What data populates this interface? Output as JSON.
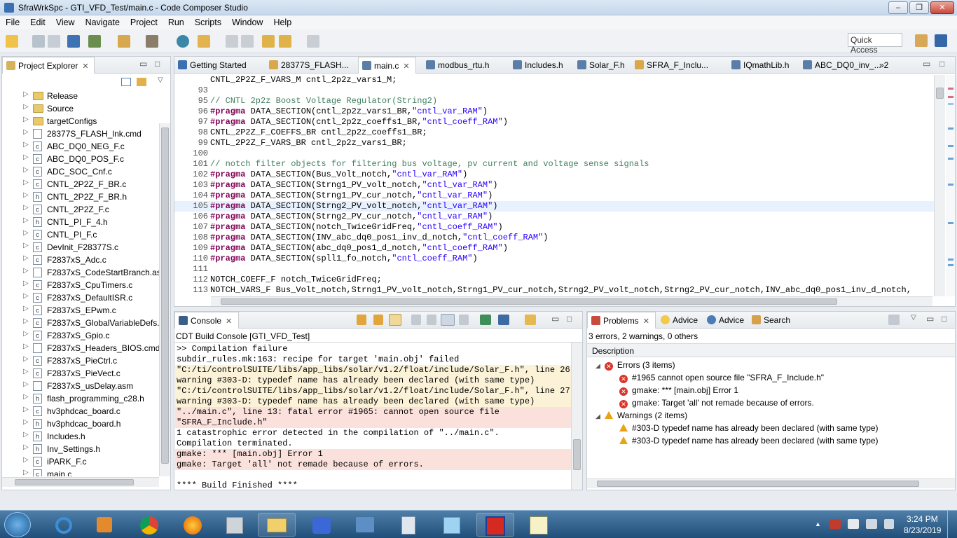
{
  "window": {
    "title": "SfraWrkSpc - GTI_VFD_Test/main.c - Code Composer Studio"
  },
  "menu": [
    "File",
    "Edit",
    "View",
    "Navigate",
    "Project",
    "Run",
    "Scripts",
    "Window",
    "Help"
  ],
  "toolbar": {
    "quick_access": "Quick Access"
  },
  "explorer": {
    "title": "Project Explorer",
    "items": [
      {
        "label": "Release",
        "kind": "folder"
      },
      {
        "label": "Source",
        "kind": "folder"
      },
      {
        "label": "targetConfigs",
        "kind": "folder"
      },
      {
        "label": "28377S_FLASH_lnk.cmd",
        "kind": "cmd"
      },
      {
        "label": "ABC_DQ0_NEG_F.c",
        "kind": "c"
      },
      {
        "label": "ABC_DQ0_POS_F.c",
        "kind": "c"
      },
      {
        "label": "ADC_SOC_Cnf.c",
        "kind": "c"
      },
      {
        "label": "CNTL_2P2Z_F_BR.c",
        "kind": "c"
      },
      {
        "label": "CNTL_2P2Z_F_BR.h",
        "kind": "h"
      },
      {
        "label": "CNTL_2P2Z_F.c",
        "kind": "c"
      },
      {
        "label": "CNTL_PI_F_4.h",
        "kind": "h"
      },
      {
        "label": "CNTL_PI_F.c",
        "kind": "c"
      },
      {
        "label": "DevInit_F28377S.c",
        "kind": "c"
      },
      {
        "label": "F2837xS_Adc.c",
        "kind": "c"
      },
      {
        "label": "F2837xS_CodeStartBranch.asm",
        "kind": "asm"
      },
      {
        "label": "F2837xS_CpuTimers.c",
        "kind": "c"
      },
      {
        "label": "F2837xS_DefaultISR.c",
        "kind": "c"
      },
      {
        "label": "F2837xS_EPwm.c",
        "kind": "c"
      },
      {
        "label": "F2837xS_GlobalVariableDefs.c",
        "kind": "c"
      },
      {
        "label": "F2837xS_Gpio.c",
        "kind": "c"
      },
      {
        "label": "F2837xS_Headers_BIOS.cmd",
        "kind": "cmd"
      },
      {
        "label": "F2837xS_PieCtrl.c",
        "kind": "c"
      },
      {
        "label": "F2837xS_PieVect.c",
        "kind": "c"
      },
      {
        "label": "F2837xS_usDelay.asm",
        "kind": "asm"
      },
      {
        "label": "flash_programming_c28.h",
        "kind": "h"
      },
      {
        "label": "hv3phdcac_board.c",
        "kind": "c"
      },
      {
        "label": "hv3phdcac_board.h",
        "kind": "h"
      },
      {
        "label": "Includes.h",
        "kind": "h"
      },
      {
        "label": "Inv_Settings.h",
        "kind": "h"
      },
      {
        "label": "iPARK_F.c",
        "kind": "c"
      },
      {
        "label": "main.c",
        "kind": "c"
      }
    ]
  },
  "editor": {
    "tabs": [
      "Getting Started",
      "28377S_FLASH...",
      "main.c",
      "modbus_rtu.h",
      "Includes.h",
      "Solar_F.h",
      "SFRA_F_Inclu...",
      "IQmathLib.h",
      "ABC_DQ0_inv_..."
    ],
    "overflow": "»2",
    "lines": [
      {
        "n": "",
        "t": "CNTL_2P2Z_F_VARS_M cntl_2p2z_vars1_M;"
      },
      {
        "n": "93",
        "t": ""
      },
      {
        "n": "95",
        "t": "// CNTL 2p2z Boost Voltage Regulator(String2)"
      },
      {
        "n": "96",
        "k": "#pragma",
        "t": " DATA_SECTION(cntl_2p2z_vars1_BR,",
        "s": "\"cntl_var_RAM\"",
        "e": ")"
      },
      {
        "n": "97",
        "k": "#pragma",
        "t": " DATA_SECTION(cntl_2p2z_coeffs1_BR,",
        "s": "\"cntl_coeff_RAM\"",
        "e": ")"
      },
      {
        "n": "98",
        "t": "CNTL_2P2Z_F_COEFFS_BR cntl_2p2z_coeffs1_BR;"
      },
      {
        "n": "99",
        "t": "CNTL_2P2Z_F_VARS_BR cntl_2p2z_vars1_BR;"
      },
      {
        "n": "100",
        "t": ""
      },
      {
        "n": "101",
        "t": "// notch filter objects for filtering bus voltage, pv current and voltage sense signals"
      },
      {
        "n": "102",
        "k": "#pragma",
        "t": " DATA_SECTION(Bus_Volt_notch,",
        "s": "\"cntl_var_RAM\"",
        "e": ")"
      },
      {
        "n": "103",
        "k": "#pragma",
        "t": " DATA_SECTION(Strng1_PV_volt_notch,",
        "s": "\"cntl_var_RAM\"",
        "e": ")"
      },
      {
        "n": "104",
        "k": "#pragma",
        "t": " DATA_SECTION(Strng1_PV_cur_notch,",
        "s": "\"cntl_var_RAM\"",
        "e": ")"
      },
      {
        "n": "105",
        "k": "#pragma",
        "t": " DATA_SECTION(Strng2_PV_volt_notch,",
        "s": "\"cntl_var_RAM\"",
        "e": ")"
      },
      {
        "n": "106",
        "k": "#pragma",
        "t": " DATA_SECTION(Strng2_PV_cur_notch,",
        "s": "\"cntl_var_RAM\"",
        "e": ")"
      },
      {
        "n": "107",
        "k": "#pragma",
        "t": " DATA_SECTION(notch_TwiceGridFreq,",
        "s": "\"cntl_coeff_RAM\"",
        "e": ")"
      },
      {
        "n": "108",
        "k": "#pragma",
        "t": " DATA_SECTION(INV_abc_dq0_pos1_inv_d_notch,",
        "s": "\"cntl_coeff_RAM\"",
        "e": ")"
      },
      {
        "n": "109",
        "k": "#pragma",
        "t": " DATA_SECTION(abc_dq0_pos1_d_notch,",
        "s": "\"cntl_coeff_RAM\"",
        "e": ")"
      },
      {
        "n": "110",
        "k": "#pragma",
        "t": " DATA_SECTION(spll1_fo_notch,",
        "s": "\"cntl_coeff_RAM\"",
        "e": ")"
      },
      {
        "n": "111",
        "t": ""
      },
      {
        "n": "112",
        "t": "NOTCH_COEFF_F notch_TwiceGridFreq;"
      },
      {
        "n": "113",
        "t": "NOTCH_VARS_F Bus_Volt_notch,Strng1_PV_volt_notch,Strng1_PV_cur_notch,Strng2_PV_volt_notch,Strng2_PV_cur_notch,INV_abc_dq0_pos1_inv_d_notch,"
      }
    ]
  },
  "console": {
    "tab": "Console",
    "header": "CDT Build Console [GTI_VFD_Test]",
    "lines": [
      {
        "t": ">> Compilation failure",
        "c": ""
      },
      {
        "t": "subdir_rules.mk:163: recipe for target 'main.obj' failed",
        "c": ""
      },
      {
        "t": "\"C:/ti/controlSUITE/libs/app_libs/solar/v1.2/float/include/Solar_F.h\", line 26:",
        "c": "warn"
      },
      {
        "t": "warning #303-D: typedef name has already been declared (with same type)",
        "c": "warn"
      },
      {
        "t": "\"C:/ti/controlSUITE/libs/app_libs/solar/v1.2/float/include/Solar_F.h\", line 27:",
        "c": "warn"
      },
      {
        "t": "warning #303-D: typedef name has already been declared (with same type)",
        "c": "warn"
      },
      {
        "t": "\"../main.c\", line 13: fatal error #1965: cannot open source file",
        "c": "err"
      },
      {
        "t": "\"SFRA_F_Include.h\"",
        "c": "err"
      },
      {
        "t": "1 catastrophic error detected in the compilation of \"../main.c\".",
        "c": ""
      },
      {
        "t": "Compilation terminated.",
        "c": ""
      },
      {
        "t": "gmake: *** [main.obj] Error 1",
        "c": "err"
      },
      {
        "t": "gmake: Target 'all' not remade because of errors.",
        "c": "err"
      },
      {
        "t": "",
        "c": ""
      },
      {
        "t": "**** Build Finished ****",
        "c": ""
      }
    ]
  },
  "problems": {
    "tabs": [
      "Problems",
      "Advice",
      "Advice",
      "Search"
    ],
    "summary": "3 errors, 2 warnings, 0 others",
    "column": "Description",
    "errors_group": "Errors (3 items)",
    "errors": [
      "#1965 cannot open source file \"SFRA_F_Include.h\"",
      "gmake: *** [main.obj] Error 1",
      "gmake: Target 'all' not remade because of errors."
    ],
    "warnings_group": "Warnings (2 items)",
    "warnings": [
      "#303-D typedef name has already been declared (with same type)",
      "#303-D typedef name has already been declared (with same type)"
    ]
  },
  "taskbar": {
    "time": "3:24 PM",
    "date": "8/23/2019"
  },
  "colors": {
    "error": "#d9362b",
    "warning": "#e8a317",
    "keyword": "#7f0055",
    "string": "#2a00ff",
    "comment": "#3f7f5f"
  }
}
